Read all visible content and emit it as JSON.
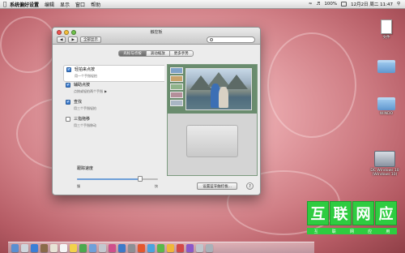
{
  "menubar": {
    "apple": "",
    "app_name": "系统偏好设置",
    "items": [
      "编辑",
      "显示",
      "窗口",
      "帮助"
    ],
    "battery": "100%",
    "date_time": "12月2日 周二 11:47"
  },
  "desktop": {
    "icons": [
      {
        "label": "文件"
      },
      {
        "label": ""
      },
      {
        "label": "WINDO"
      },
      {
        "label": "DC Windows 10 (Windows 10)"
      }
    ]
  },
  "window": {
    "title": "触控板",
    "back_icon": "back-arrow-icon",
    "forward_icon": "forward-arrow-icon",
    "show_all": "全部显示",
    "search_placeholder": "",
    "tabs": [
      {
        "label": "光标与点按",
        "active": true
      },
      {
        "label": "滚动缩放",
        "active": false
      },
      {
        "label": "更多手势",
        "active": false
      }
    ],
    "options": [
      {
        "title": "轻拍来点按",
        "subtitle": "用一个手指轻拍",
        "checked": true,
        "has_arrow": false
      },
      {
        "title": "辅助点按",
        "subtitle": "点按或轻拍两个手指",
        "checked": true,
        "has_arrow": true
      },
      {
        "title": "查找",
        "subtitle": "用三个手指轻拍",
        "checked": true,
        "has_arrow": false
      },
      {
        "title": "三指拖移",
        "subtitle": "用三个手指移动",
        "checked": false,
        "has_arrow": false
      }
    ],
    "tracking_speed": {
      "label": "跟踪速度",
      "min_label": "慢",
      "max_label": "快",
      "value": 0.78
    },
    "setup_button": "设置蓝牙触控板...",
    "help": "?"
  },
  "watermark": {
    "chars": [
      "互",
      "联",
      "网",
      "应",
      "用"
    ],
    "sub": [
      "互",
      "联",
      "网",
      "应",
      "用"
    ]
  },
  "colors": {
    "accent": "#2f6fc7",
    "watermark_green": "#2ecc40"
  }
}
